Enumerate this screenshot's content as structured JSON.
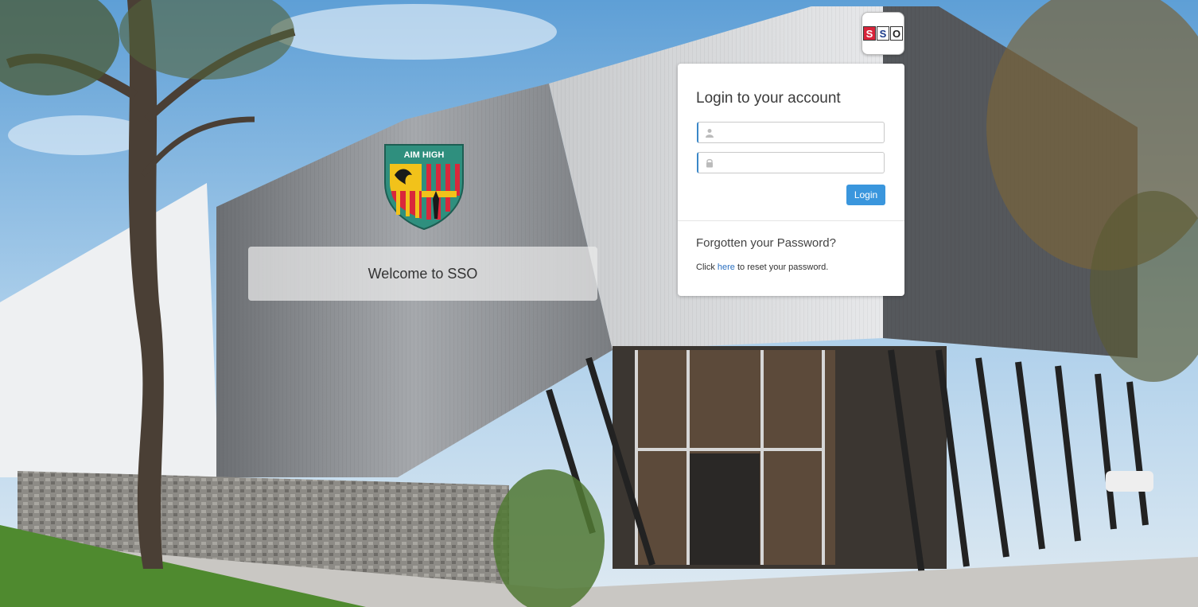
{
  "background": {
    "description_icon": "school-building-photo"
  },
  "crest": {
    "motto": "AIM HIGH",
    "colors": {
      "field": "#2f8f7e",
      "stripe_red": "#d9283b",
      "stripe_yellow": "#f2c21a"
    }
  },
  "welcome": {
    "text": "Welcome to SSO"
  },
  "logo": {
    "letters": [
      "S",
      "S",
      "O"
    ]
  },
  "login": {
    "title": "Login to your account",
    "username_icon": "user-icon",
    "password_icon": "lock-icon",
    "username_value": "",
    "password_value": "",
    "button_label": "Login",
    "button_color": "#3a96dd"
  },
  "forgot": {
    "title": "Forgotten your Password?",
    "prefix": "Click ",
    "link": "here",
    "suffix": " to reset your password."
  }
}
